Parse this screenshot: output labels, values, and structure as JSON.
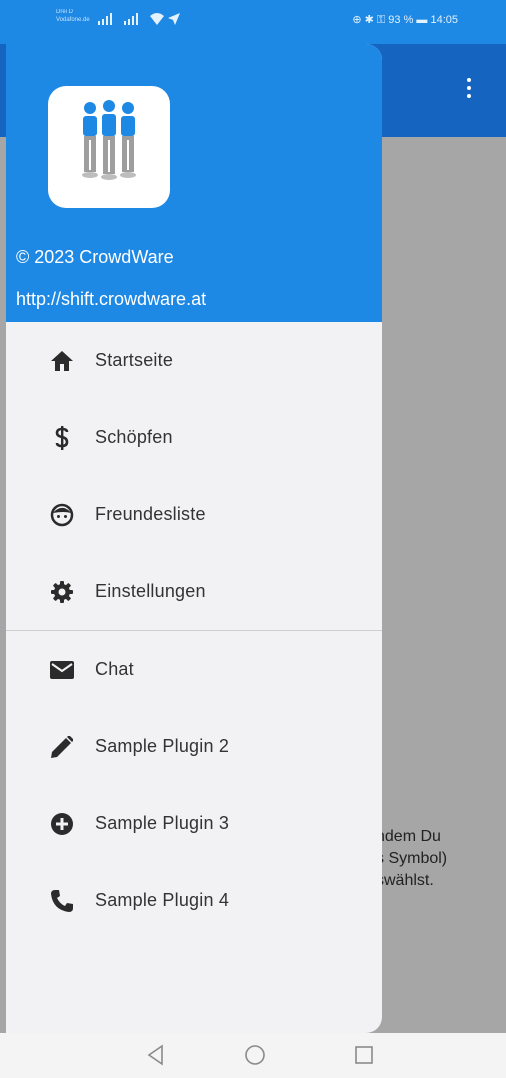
{
  "status_bar": {
    "carrier_line1": "Drei D",
    "carrier_line2": "Vodafone.de",
    "right_text": "⊕ ✱ ⚿ 93 % ▬ 14:05"
  },
  "drawer": {
    "copyright": "© 2023 CrowdWare",
    "website": "http://shift.crowdware.at",
    "items": [
      {
        "label": "Startseite",
        "icon": "home-icon"
      },
      {
        "label": "Schöpfen",
        "icon": "dollar-icon"
      },
      {
        "label": "Freundesliste",
        "icon": "face-icon"
      },
      {
        "label": "Einstellungen",
        "icon": "gear-icon"
      },
      {
        "label": "Chat",
        "icon": "mail-icon"
      },
      {
        "label": "Sample Plugin 2",
        "icon": "pencil-icon"
      },
      {
        "label": "Sample Plugin 3",
        "icon": "add-circle-icon"
      },
      {
        "label": "Sample Plugin 4",
        "icon": "phone-icon"
      }
    ]
  },
  "background": {
    "partial_text": "ndem Du\ns Symbol)\nswählst."
  },
  "colors": {
    "header_blue": "#1e88e5",
    "app_bar_blue": "#1565c0",
    "scrim_gray": "#a6a6a6",
    "drawer_bg": "#f2f2f4"
  }
}
